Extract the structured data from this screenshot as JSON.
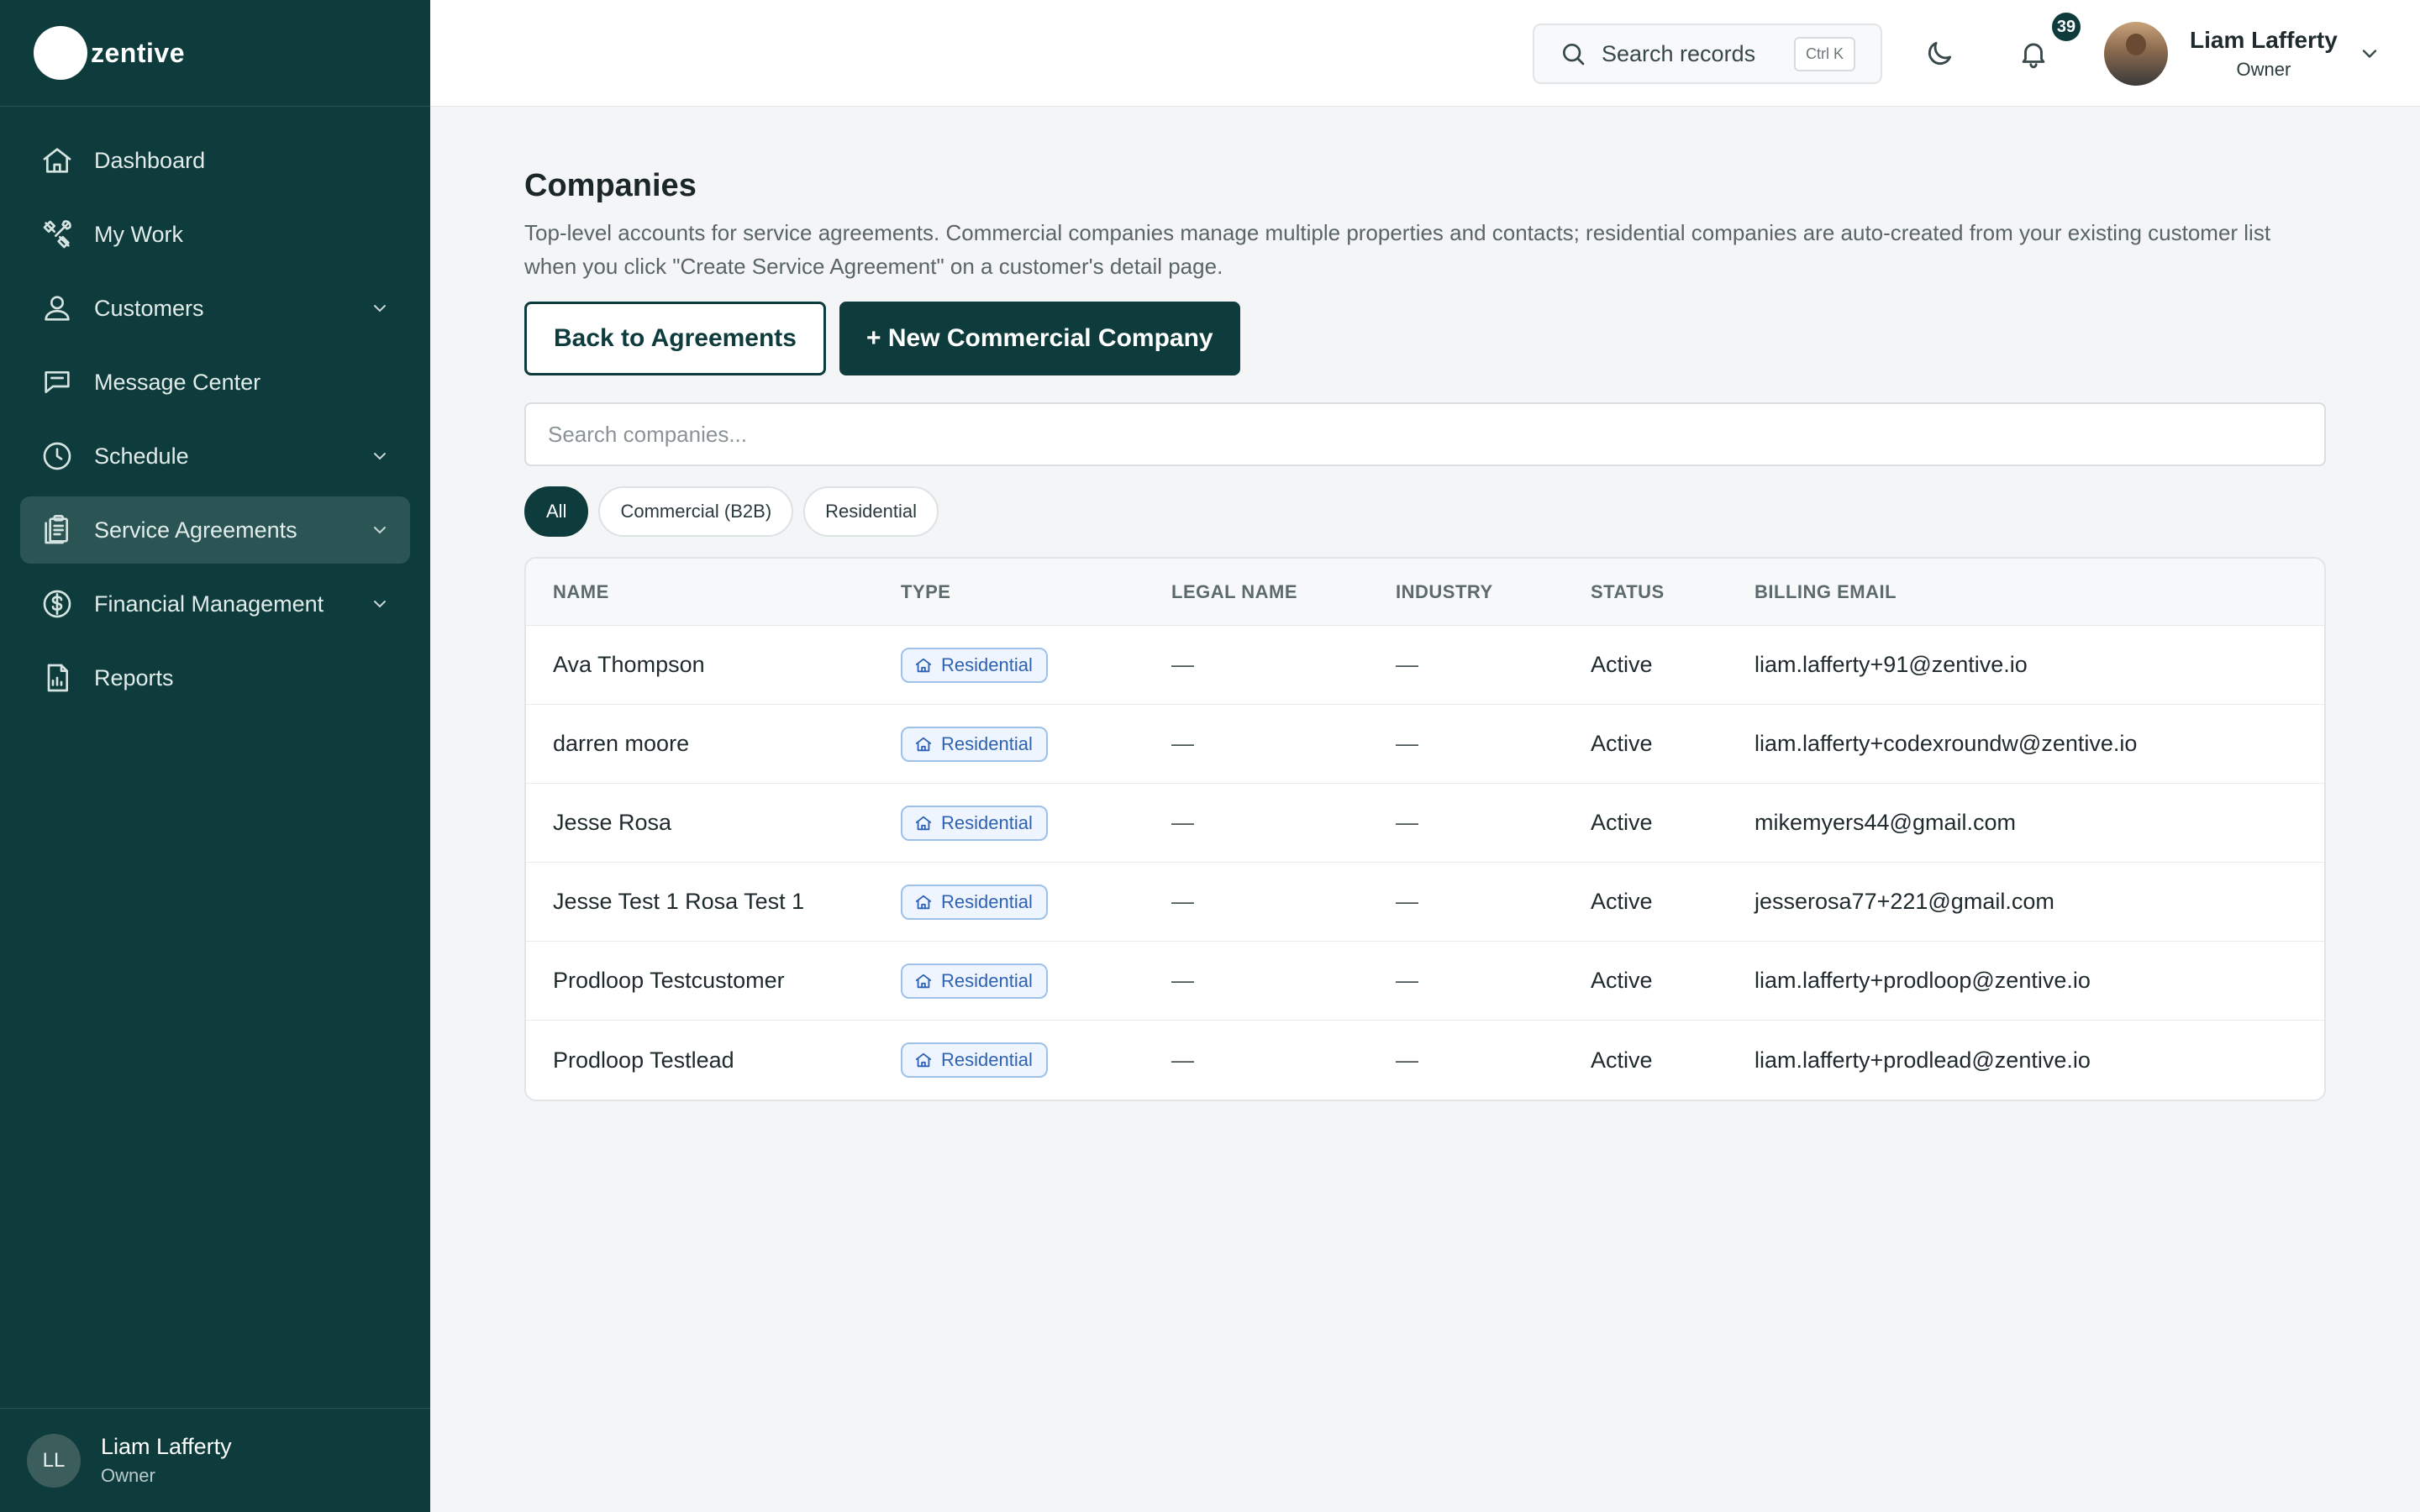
{
  "brand": {
    "name": "zentive"
  },
  "sidebar": {
    "items": [
      {
        "label": "Dashboard",
        "icon": "home-icon",
        "has_chevron": false,
        "active": false
      },
      {
        "label": "My Work",
        "icon": "tools-icon",
        "has_chevron": false,
        "active": false
      },
      {
        "label": "Customers",
        "icon": "users-icon",
        "has_chevron": true,
        "active": false
      },
      {
        "label": "Message Center",
        "icon": "chat-icon",
        "has_chevron": false,
        "active": false
      },
      {
        "label": "Schedule",
        "icon": "clock-icon",
        "has_chevron": true,
        "active": false
      },
      {
        "label": "Service Agreements",
        "icon": "clipboard-icon",
        "has_chevron": true,
        "active": true
      },
      {
        "label": "Financial Management",
        "icon": "dollar-icon",
        "has_chevron": true,
        "active": false
      },
      {
        "label": "Reports",
        "icon": "report-icon",
        "has_chevron": false,
        "active": false
      }
    ],
    "user": {
      "initials": "LL",
      "name": "Liam Lafferty",
      "role": "Owner"
    }
  },
  "topbar": {
    "search_label": "Search records",
    "search_shortcut": "Ctrl K",
    "notifications_count": "39",
    "user": {
      "name": "Liam Lafferty",
      "role": "Owner"
    }
  },
  "main": {
    "title": "Companies",
    "description": "Top-level accounts for service agreements. Commercial companies manage multiple properties and contacts; residential companies are auto-created from your existing customer list when you click \"Create Service Agreement\" on a customer's detail page.",
    "back_button": "Back to Agreements",
    "new_button": "+ New Commercial Company",
    "search_placeholder": "Search companies...",
    "filters": [
      {
        "label": "All",
        "active": true
      },
      {
        "label": "Commercial (B2B)",
        "active": false
      },
      {
        "label": "Residential",
        "active": false
      }
    ],
    "table": {
      "columns": [
        "NAME",
        "TYPE",
        "LEGAL NAME",
        "INDUSTRY",
        "STATUS",
        "BILLING EMAIL"
      ],
      "rows": [
        {
          "name": "Ava Thompson",
          "type": "Residential",
          "legal_name": "—",
          "industry": "—",
          "status": "Active",
          "email": "liam.lafferty+91@zentive.io"
        },
        {
          "name": "darren moore",
          "type": "Residential",
          "legal_name": "—",
          "industry": "—",
          "status": "Active",
          "email": "liam.lafferty+codexroundw@zentive.io"
        },
        {
          "name": "Jesse Rosa",
          "type": "Residential",
          "legal_name": "—",
          "industry": "—",
          "status": "Active",
          "email": "mikemyers44@gmail.com"
        },
        {
          "name": "Jesse Test 1 Rosa Test 1",
          "type": "Residential",
          "legal_name": "—",
          "industry": "—",
          "status": "Active",
          "email": "jesserosa77+221@gmail.com"
        },
        {
          "name": "Prodloop Testcustomer",
          "type": "Residential",
          "legal_name": "—",
          "industry": "—",
          "status": "Active",
          "email": "liam.lafferty+prodloop@zentive.io"
        },
        {
          "name": "Prodloop Testlead",
          "type": "Residential",
          "legal_name": "—",
          "industry": "—",
          "status": "Active",
          "email": "liam.lafferty+prodlead@zentive.io"
        }
      ]
    }
  },
  "colors": {
    "sidebar_bg": "#0e3b3b",
    "accent": "#0e3b3b",
    "badge_blue": "#2e62b4",
    "page_bg": "#f3f5f7"
  }
}
